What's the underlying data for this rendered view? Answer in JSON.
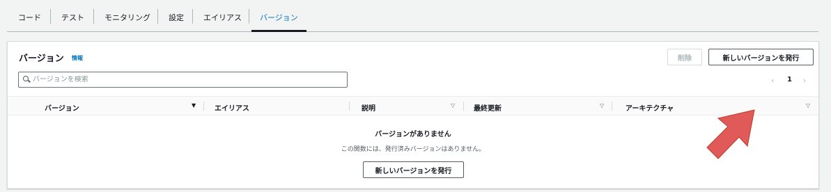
{
  "tabs": [
    "コード",
    "テスト",
    "モニタリング",
    "設定",
    "エイリアス",
    "バージョン"
  ],
  "panel": {
    "title": "バージョン",
    "info": "情報",
    "delete_label": "削除",
    "publish_label": "新しいバージョンを発行",
    "search_placeholder": "バージョンを検索",
    "pagination": {
      "prev": "‹",
      "page": "1",
      "next": "›"
    }
  },
  "table": {
    "columns": [
      "バージョン",
      "エイリアス",
      "説明",
      "最終更新",
      "アーキテクチャ"
    ],
    "sort_icons": [
      "▼",
      "▽",
      "▽",
      "▽"
    ]
  },
  "empty_state": {
    "title": "バージョンがありません",
    "description": "この関数には、発行済みバージョンはありません。",
    "button_label": "新しいバージョンを発行"
  },
  "colors": {
    "accent": "#0073bb",
    "annotation_arrow": "#e05a5a"
  }
}
